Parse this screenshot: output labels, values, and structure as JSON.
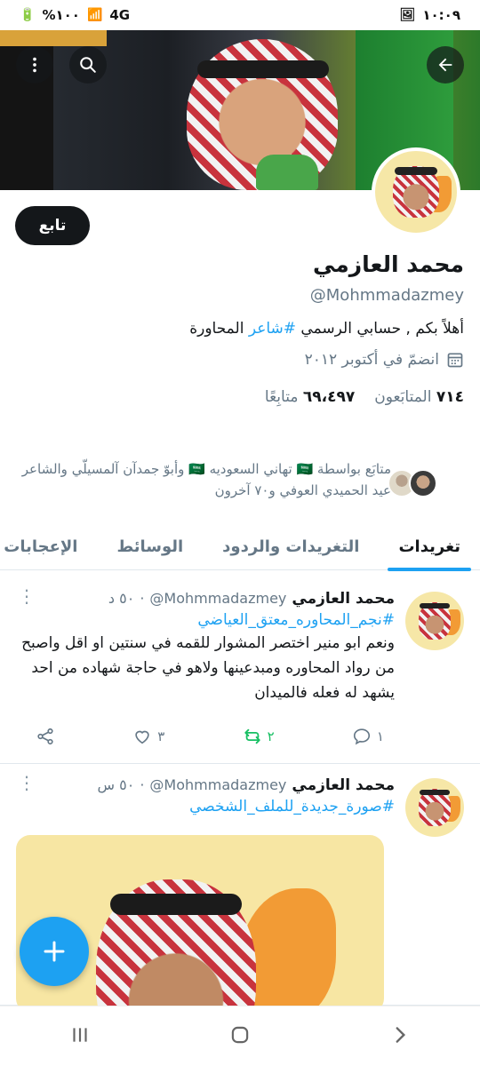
{
  "status_bar": {
    "time": "١٠:٠٩",
    "battery": "%١٠٠",
    "network": "4G"
  },
  "profile": {
    "name": "محمد العازمي",
    "handle": "@Mohmmadazmey",
    "bio_prefix": "أهلاً بكم , حسابي الرسمي ",
    "bio_hashtag": "#شاعر",
    "bio_suffix": " المحاورة",
    "joined": "انضمّ في أكتوبر ٢٠١٢",
    "following_count": "٧١٤",
    "following_label": "المتابَعون",
    "followers_count": "٦٩،٤٩٧",
    "followers_label": "متابِعًا",
    "follow_button": "تابع",
    "known_followers_line1": "متابَع بواسطة 🇸🇦 تهاني السعوديه 🇸🇦 وأبوّ جمدآن آلمسيلّي والشاعر",
    "known_followers_line2": "عيد الحميدي العوفي و٧٠ آخرون"
  },
  "tabs": [
    {
      "label": "تغريدات",
      "active": true
    },
    {
      "label": "التغريدات والردود",
      "active": false
    },
    {
      "label": "الوسائط",
      "active": false
    },
    {
      "label": "الإعجابات",
      "active": false
    }
  ],
  "tweets": [
    {
      "name": "محمد العازمي",
      "handle": "@Mohmmadazmey",
      "time": "٥٠ د",
      "hashtag": "#نجم_المحاوره_معتق_العياضي",
      "text": "ونعم ابو منير اختصر المشوار للقمه في سنتين او اقل واصبح من رواد المحاوره ومبدعينها  ولاهو في حاجة شهاده من احد يشهد له فعله فالميدان",
      "replies": "١",
      "retweets": "٢",
      "likes": "٣"
    },
    {
      "name": "محمد العازمي",
      "handle": "@Mohmmadazmey",
      "time": "٥٠ س",
      "hashtag": "#صورة_جديدة_للملف_الشخصي"
    }
  ],
  "icons": {
    "back": "arrow-left-icon",
    "search": "search-icon",
    "more": "more-vertical-icon",
    "calendar": "calendar-icon",
    "reply": "reply-icon",
    "retweet": "retweet-icon",
    "like": "heart-icon",
    "share": "share-icon",
    "compose": "plus-icon"
  },
  "colors": {
    "accent": "#1da1f2",
    "retweet": "#17bf63",
    "text": "#14171a",
    "muted": "#657786"
  }
}
